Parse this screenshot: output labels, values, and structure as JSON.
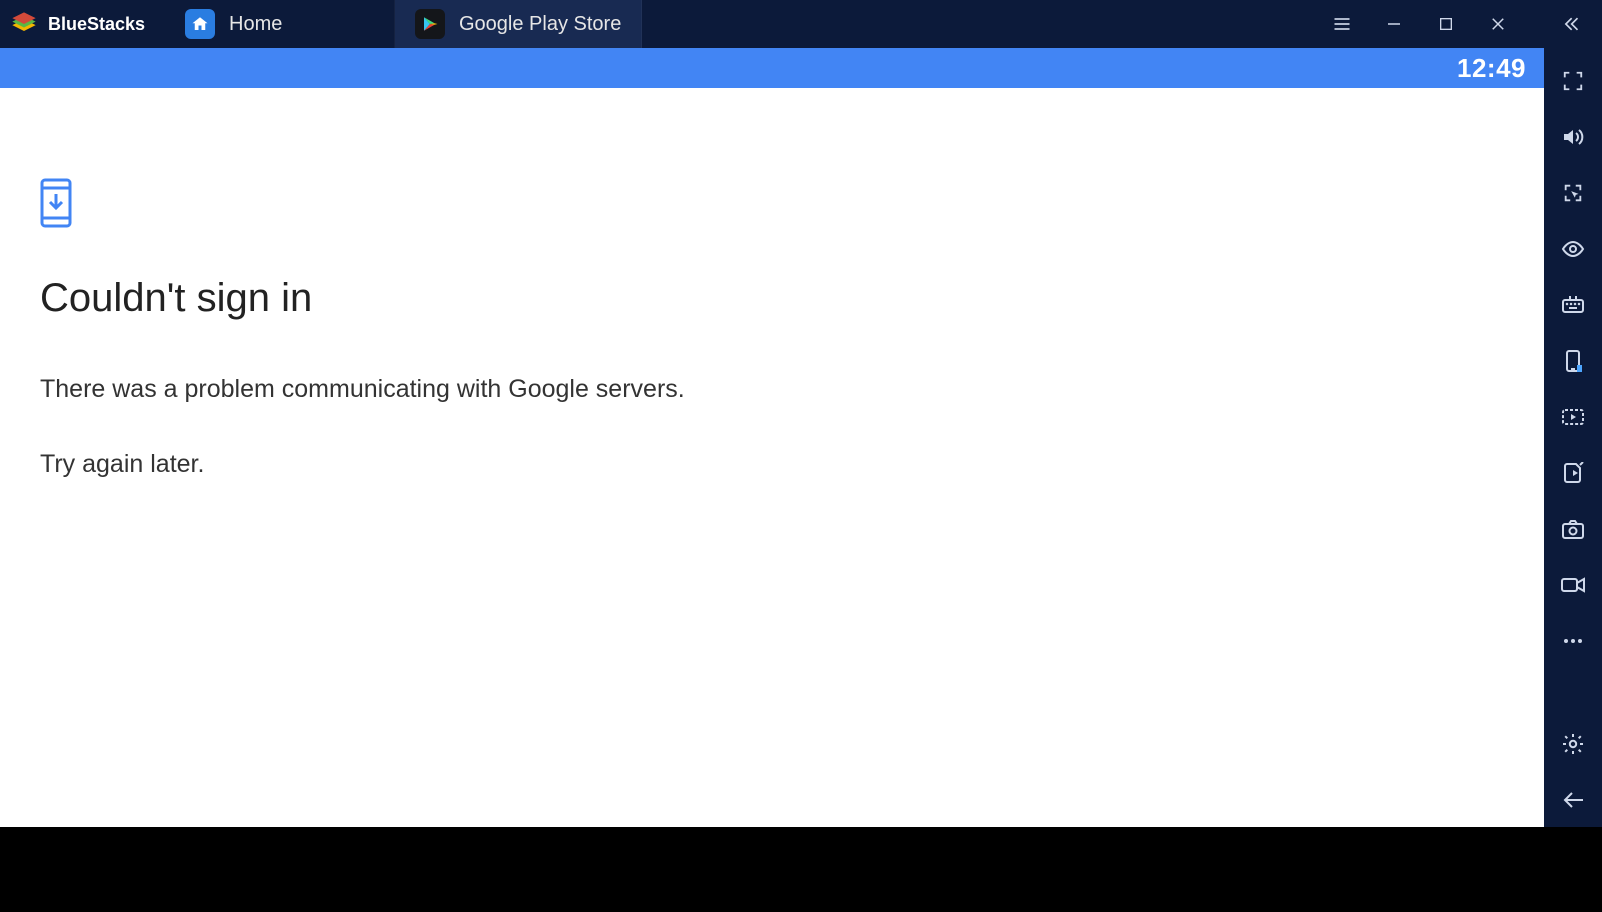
{
  "app": {
    "title": "BlueStacks"
  },
  "tabs": [
    {
      "label": "Home",
      "icon": "home-icon",
      "active": false
    },
    {
      "label": "Google Play Store",
      "icon": "play-store-icon",
      "active": true
    }
  ],
  "statusbar": {
    "time": "12:49"
  },
  "page": {
    "heading": "Couldn't sign in",
    "line1": "There was a problem communicating with Google servers.",
    "line2": "Try again later."
  },
  "window_controls": {
    "menu": "menu-icon",
    "minimize": "minimize-icon",
    "maximize": "maximize-icon",
    "close": "close-icon",
    "collapse": "collapse-sidebar-icon"
  },
  "sidebar_tools": [
    {
      "name": "fullscreen-icon"
    },
    {
      "name": "volume-icon"
    },
    {
      "name": "location-cursor-icon"
    },
    {
      "name": "eye-icon"
    },
    {
      "name": "keyboard-icon"
    },
    {
      "name": "rotate-device-icon"
    },
    {
      "name": "media-folder-icon"
    },
    {
      "name": "install-apk-icon"
    },
    {
      "name": "screenshot-icon"
    },
    {
      "name": "record-video-icon"
    },
    {
      "name": "more-icon"
    }
  ],
  "sidebar_bottom": [
    {
      "name": "settings-gear-icon"
    },
    {
      "name": "back-arrow-icon"
    }
  ]
}
